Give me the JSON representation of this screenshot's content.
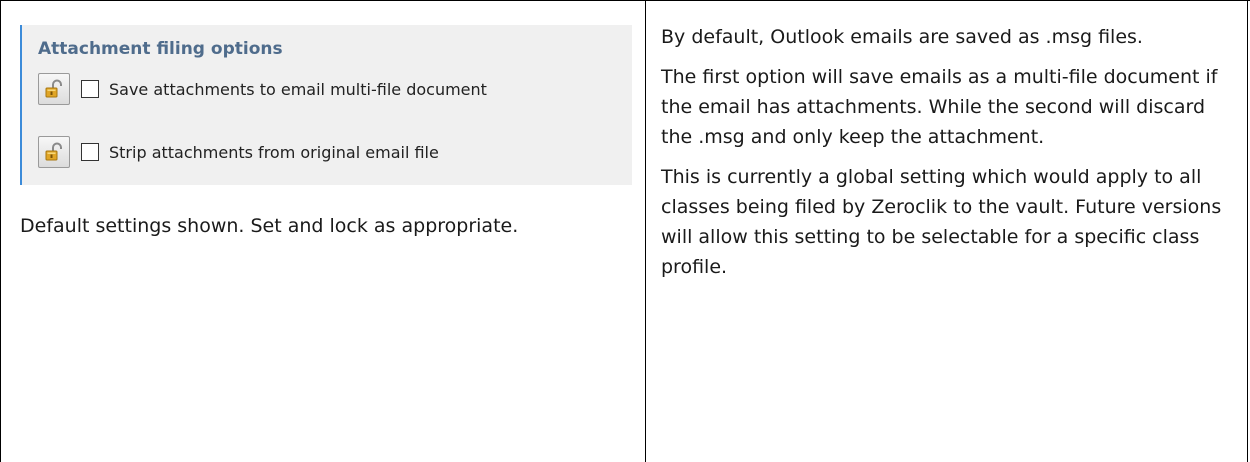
{
  "left_cell": {
    "panel": {
      "heading": "Attachment filing options",
      "options": [
        {
          "label": "Save attachments to email multi-file document",
          "checked": false,
          "lock_icon": "padlock-open-icon"
        },
        {
          "label": "Strip attachments from original email file",
          "checked": false,
          "lock_icon": "padlock-open-icon"
        }
      ]
    },
    "caption": "Default settings shown. Set and lock as appropriate."
  },
  "right_cell": {
    "paragraphs": [
      "By default, Outlook emails are saved as .msg files.",
      "The first option will save emails as a multi-file document if the email has attachments. While the second will discard the .msg and only keep the attachment.",
      "This is currently a global setting which would apply to all classes being filed by Zeroclik to the vault. Future versions will allow this setting to be selectable for a specific class profile."
    ]
  },
  "colors": {
    "panel_background": "#f0f0f0",
    "panel_accent": "#3c8bd9",
    "heading_text": "#4f6c8c",
    "lock_gold": "#d4a017"
  }
}
